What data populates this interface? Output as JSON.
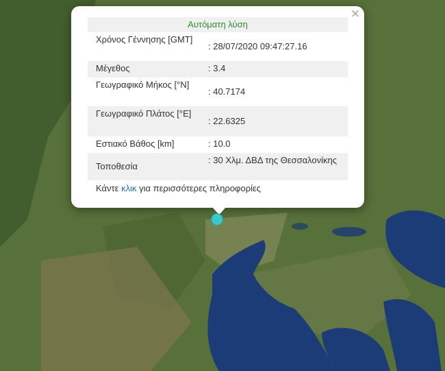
{
  "popup": {
    "title": "Αυτόματη λύση",
    "close": "×",
    "rows": [
      {
        "label": "Χρόνος Γέννησης [GMT]",
        "value": ": 28/07/2020 09:47:27.16"
      },
      {
        "label": "Μέγεθος",
        "value": ": 3.4"
      },
      {
        "label": "Γεωγραφικό Μήκος [°N]",
        "value": ": 40.7174"
      },
      {
        "label": "Γεωγραφικό Πλάτος [°E]",
        "value": ": 22.6325"
      },
      {
        "label": "Εστιακό Βάθος [km]",
        "value": ": 10.0"
      },
      {
        "label": "Τοποθεσία",
        "value": ": 30 Χλμ. ΔΒΔ της Θεσσαλονίκης"
      }
    ],
    "more_prefix": "Κάντε ",
    "more_link": "κλικ",
    "more_suffix": " για περισσότερες πληροφορίες"
  },
  "colors": {
    "land": "#58703a",
    "sea": "#1c3c78",
    "title_green": "#2e8b2e",
    "marker": "#3cc8c8",
    "link": "#1a6fc4"
  }
}
